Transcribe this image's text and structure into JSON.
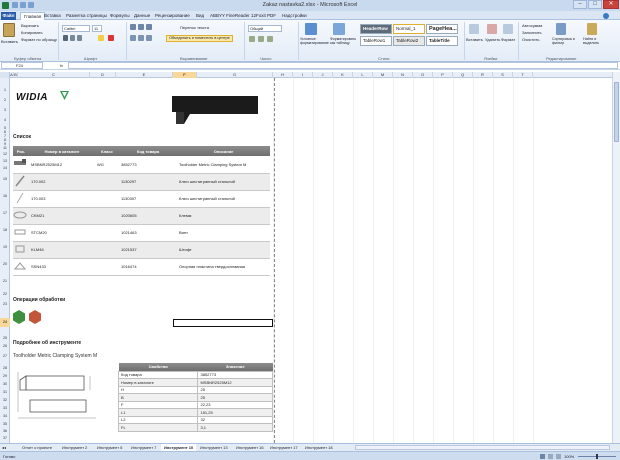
{
  "window": {
    "title": "Zakaz nastavka2.xlsx - Microsoft Excel",
    "min": "–",
    "max": "□",
    "close": "✕"
  },
  "ribbon_tabs": [
    "Файл",
    "Главная",
    "Вставка",
    "Разметка страницы",
    "Формулы",
    "Данные",
    "Рецензирование",
    "Вид",
    "ABBYY FineReader 12",
    "Foxit PDF",
    "Надстройки"
  ],
  "clipboard": {
    "paste": "Вставить",
    "cut": "Вырезать",
    "copy": "Копировать",
    "format_painter": "Формат по образцу",
    "group": "Буфер обмена"
  },
  "font": {
    "name": "Calibri",
    "size": "11",
    "group": "Шрифт"
  },
  "alignment": {
    "wrap": "Перенос текста",
    "merge": "Объединить и поместить в центре",
    "group": "Выравнивание"
  },
  "number": {
    "format": "Общий",
    "group": "Число"
  },
  "styles": {
    "conditional": "Условное форматирование",
    "as_table": "Форматировать как таблицу",
    "cells": [
      "HeaderRow",
      "Normal_1",
      "PageHea...",
      "TableRow1",
      "TableRow2",
      "TableTitle"
    ],
    "group": "Стили"
  },
  "cells_group": {
    "insert": "Вставить",
    "delete": "Удалить",
    "format": "Формат",
    "group": "Ячейки"
  },
  "editing": {
    "autosum": "Автосумма",
    "fill": "Заполнить",
    "clear": "Очистить",
    "sort": "Сортировка и фильтр",
    "find": "Найти и выделить",
    "group": "Редактирование"
  },
  "formula_bar": {
    "name_box": "F24",
    "fx": "fx",
    "value": ""
  },
  "columns": [
    "A",
    "B",
    "C",
    "D",
    "E",
    "F",
    "G",
    "H",
    "I",
    "J",
    "K",
    "L",
    "M",
    "N",
    "O",
    "P",
    "Q",
    "R",
    "S",
    "T"
  ],
  "active_column": "F",
  "rows": [
    "1",
    "2",
    "3",
    "4",
    "5",
    "6",
    "7",
    "8",
    "9",
    "10",
    "11",
    "12",
    "13",
    "14",
    "15",
    "16",
    "17",
    "18",
    "19",
    "20",
    "21",
    "22",
    "23",
    "24",
    "25",
    "26",
    "27",
    "28",
    "29",
    "30",
    "31",
    "32",
    "33",
    "34",
    "35",
    "36",
    "37"
  ],
  "active_row": "24",
  "doc": {
    "logo": "WIDIA",
    "list_title": "Список",
    "parts_headers": [
      "Рис.",
      "Номер в каталоге",
      "Класс",
      "Код товара",
      "Описание"
    ],
    "parts": [
      {
        "catalog": "MSBNR2525M12",
        "class": "WG",
        "code": "3852773",
        "desc": "Toolholder Metric Clamping System M"
      },
      {
        "catalog": "170.002",
        "class": "",
        "code": "1130297",
        "desc": "Ключ шестигранный стальной"
      },
      {
        "catalog": "170.003",
        "class": "",
        "code": "1130307",
        "desc": "Ключ шестигранный стальной"
      },
      {
        "catalog": "CKM21",
        "class": "",
        "code": "1020605",
        "desc": "Клемм"
      },
      {
        "catalog": "STCM20",
        "class": "",
        "code": "1021463",
        "desc": "Винт"
      },
      {
        "catalog": "KLM46",
        "class": "",
        "code": "1021537",
        "desc": "Штифт"
      },
      {
        "catalog": "SSN433",
        "class": "",
        "code": "1016474",
        "desc": "Опорная пластина твердосплавная"
      }
    ],
    "ops_title": "Операции обработки",
    "details_title": "Подробнее об инструменте",
    "details_subtitle": "Toolholder Metric Clamping System M",
    "props_headers": [
      "Свойство",
      "Значение"
    ],
    "props": [
      [
        "Код товара",
        "3852773"
      ],
      [
        "Номер в каталоге",
        "MSBNR2525M12"
      ],
      [
        "H",
        "25"
      ],
      [
        "B",
        "25"
      ],
      [
        "F",
        "22,23"
      ],
      [
        "L1",
        "151,25"
      ],
      [
        "L2",
        "32"
      ],
      [
        "FL",
        "3,1"
      ]
    ]
  },
  "sheet_tabs": [
    "Отчет о проекте",
    "Инструмент 2",
    "Инструмент 5",
    "Инструмент 7",
    "Инструмент 10",
    "Инструмент 13",
    "Инструмент 16",
    "Инструмент 17",
    "Инструмент 18"
  ],
  "active_sheet": "Инструмент 10",
  "status": {
    "ready": "Готово",
    "zoom": "100%"
  }
}
